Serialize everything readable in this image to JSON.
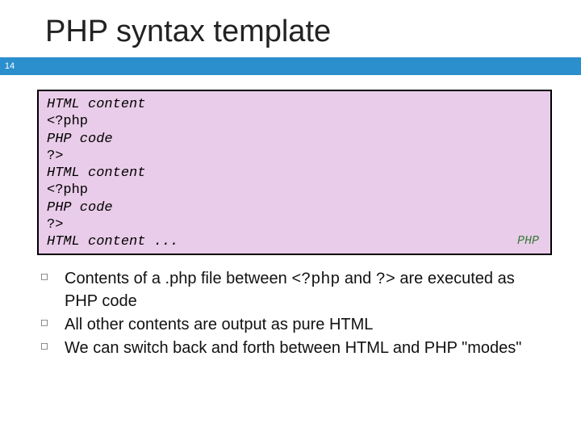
{
  "title": "PHP syntax template",
  "page_number": "14",
  "code": {
    "l1": "HTML content",
    "l2": "<?php",
    "l3": "PHP code",
    "l4": "?>",
    "l5": "HTML content",
    "l6": "<?php",
    "l7": "PHP code",
    "l8": "?>",
    "l9": "HTML content ...",
    "lang_label": "PHP"
  },
  "bullets": {
    "b1_a": "Contents of a .php file between ",
    "b1_b": "<?php",
    "b1_c": " and ",
    "b1_d": "?>",
    "b1_e": " are executed as PHP code",
    "b2": "All other contents are output as pure HTML",
    "b3": "We can switch back and forth between HTML and PHP \"modes\""
  }
}
